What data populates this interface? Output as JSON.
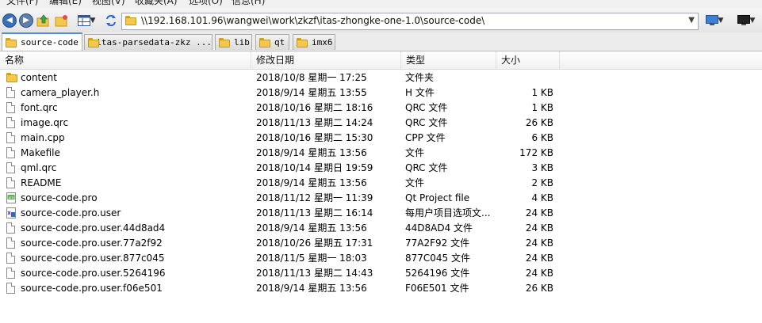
{
  "menu": [
    "文件(F)",
    "编辑(E)",
    "视图(V)",
    "收藏夹(A)",
    "选项(O)",
    "信息(H)"
  ],
  "address": {
    "path": "\\\\192.168.101.96\\wangwei\\work\\zkzf\\itas-zhongke-one-1.0\\source-code\\"
  },
  "tabs": [
    {
      "label": "source-code"
    },
    {
      "label": "itas-parsedata-zkz ..."
    },
    {
      "label": "lib"
    },
    {
      "label": "qt"
    },
    {
      "label": "imx6"
    }
  ],
  "columns": {
    "name": "名称",
    "date": "修改日期",
    "type": "类型",
    "size": "大小"
  },
  "files": [
    {
      "name": "content",
      "date": "2018/10/8 星期一 17:25",
      "type": "文件夹",
      "size": "",
      "icon": "folder-icon"
    },
    {
      "name": "camera_player.h",
      "date": "2018/9/14 星期五 13:55",
      "type": "H 文件",
      "size": "1 KB",
      "icon": "file-icon"
    },
    {
      "name": "font.qrc",
      "date": "2018/10/16 星期二 18:16",
      "type": "QRC 文件",
      "size": "1 KB",
      "icon": "file-icon"
    },
    {
      "name": "image.qrc",
      "date": "2018/11/13 星期二 14:24",
      "type": "QRC 文件",
      "size": "26 KB",
      "icon": "file-icon"
    },
    {
      "name": "main.cpp",
      "date": "2018/10/16 星期二 15:30",
      "type": "CPP 文件",
      "size": "6 KB",
      "icon": "file-icon"
    },
    {
      "name": "Makefile",
      "date": "2018/9/14 星期五 13:56",
      "type": "文件",
      "size": "172 KB",
      "icon": "file-icon"
    },
    {
      "name": "qml.qrc",
      "date": "2018/10/14 星期日 19:59",
      "type": "QRC 文件",
      "size": "3 KB",
      "icon": "file-icon"
    },
    {
      "name": "README",
      "date": "2018/9/14 星期五 13:56",
      "type": "文件",
      "size": "2 KB",
      "icon": "file-icon"
    },
    {
      "name": "source-code.pro",
      "date": "2018/11/12 星期一 11:39",
      "type": "Qt Project file",
      "size": "4 KB",
      "icon": "qt-project-icon"
    },
    {
      "name": "source-code.pro.user",
      "date": "2018/11/13 星期二 16:14",
      "type": "每用户项目选项文...",
      "size": "24 KB",
      "icon": "xml-user-icon"
    },
    {
      "name": "source-code.pro.user.44d8ad4",
      "date": "2018/9/14 星期五 13:56",
      "type": "44D8AD4 文件",
      "size": "24 KB",
      "icon": "file-icon"
    },
    {
      "name": "source-code.pro.user.77a2f92",
      "date": "2018/10/26 星期五 17:31",
      "type": "77A2F92 文件",
      "size": "24 KB",
      "icon": "file-icon"
    },
    {
      "name": "source-code.pro.user.877c045",
      "date": "2018/11/5 星期一 18:03",
      "type": "877C045 文件",
      "size": "24 KB",
      "icon": "file-icon"
    },
    {
      "name": "source-code.pro.user.5264196",
      "date": "2018/11/13 星期二 14:43",
      "type": "5264196 文件",
      "size": "24 KB",
      "icon": "file-icon"
    },
    {
      "name": "source-code.pro.user.f06e501",
      "date": "2018/9/14 星期五 13:56",
      "type": "F06E501 文件",
      "size": "26 KB",
      "icon": "file-icon"
    }
  ]
}
